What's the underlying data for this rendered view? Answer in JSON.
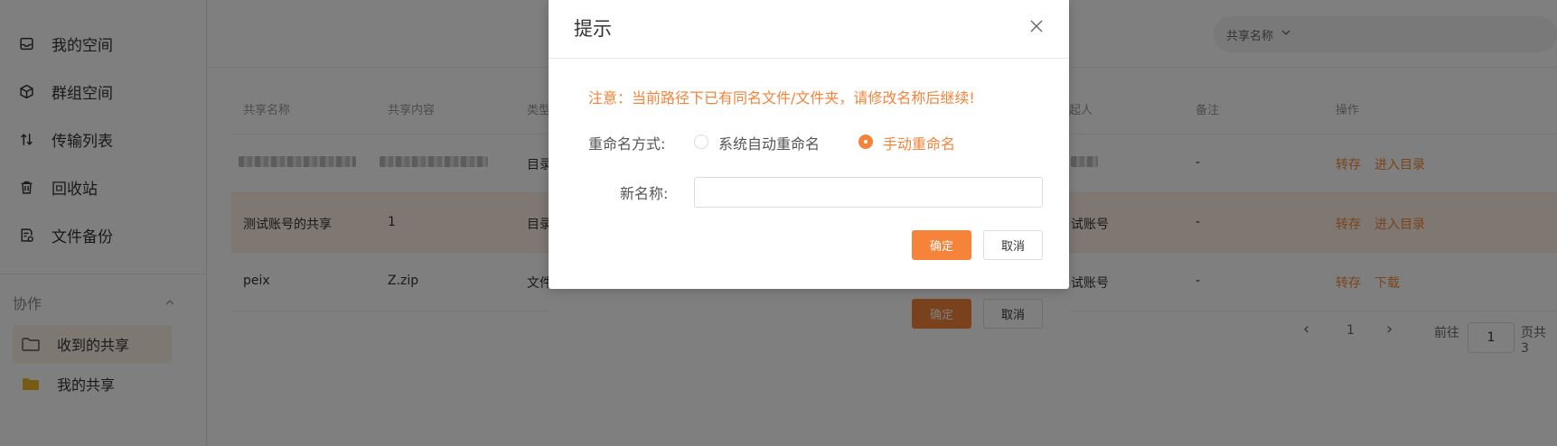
{
  "sidebar": {
    "items": [
      {
        "label": "我的空间",
        "icon": "inbox-icon"
      },
      {
        "label": "群组空间",
        "icon": "cube-icon"
      },
      {
        "label": "传输列表",
        "icon": "transfer-icon"
      },
      {
        "label": "回收站",
        "icon": "trash-icon"
      },
      {
        "label": "文件备份",
        "icon": "backup-icon"
      }
    ],
    "section_title": "协作",
    "sub_items": [
      {
        "label": "收到的共享",
        "icon": "folder-icon"
      },
      {
        "label": "我的共享",
        "icon": "folder-icon"
      }
    ]
  },
  "search": {
    "filter_label": "共享名称"
  },
  "table": {
    "headers": [
      "共享名称",
      "共享内容",
      "类型",
      "起人",
      "备注",
      "操作"
    ],
    "rows": [
      {
        "name": "",
        "content": "",
        "type": "目录",
        "sharer": "",
        "note": "-",
        "actions": [
          "转存",
          "进入目录"
        ]
      },
      {
        "name": "测试账号的共享",
        "content": "1",
        "type": "目录",
        "sharer": "试账号",
        "note": "-",
        "actions": [
          "转存",
          "进入目录"
        ]
      },
      {
        "name": "peix",
        "content": "Z.zip",
        "type": "文件",
        "sharer": "试账号",
        "note": "-",
        "actions": [
          "转存",
          "下载"
        ]
      }
    ]
  },
  "pagination": {
    "prev": "‹",
    "current": "1",
    "next": "›",
    "goto_label": "前往",
    "goto_value": "1",
    "suffix": "页共 3"
  },
  "ghost_dialog": {
    "confirm": "确定",
    "cancel": "取消"
  },
  "dialog": {
    "title": "提示",
    "warning": "注意：当前路径下已有同名文件/文件夹，请修改名称后继续!",
    "rename_mode_label": "重命名方式:",
    "option_auto": "系统自动重命名",
    "option_manual": "手动重命名",
    "selected_option": "手动重命名",
    "new_name_label": "新名称:",
    "new_name_value": "",
    "confirm": "确定",
    "cancel": "取消"
  },
  "colors": {
    "accent": "#f5833a",
    "folder": "#f0b429"
  }
}
